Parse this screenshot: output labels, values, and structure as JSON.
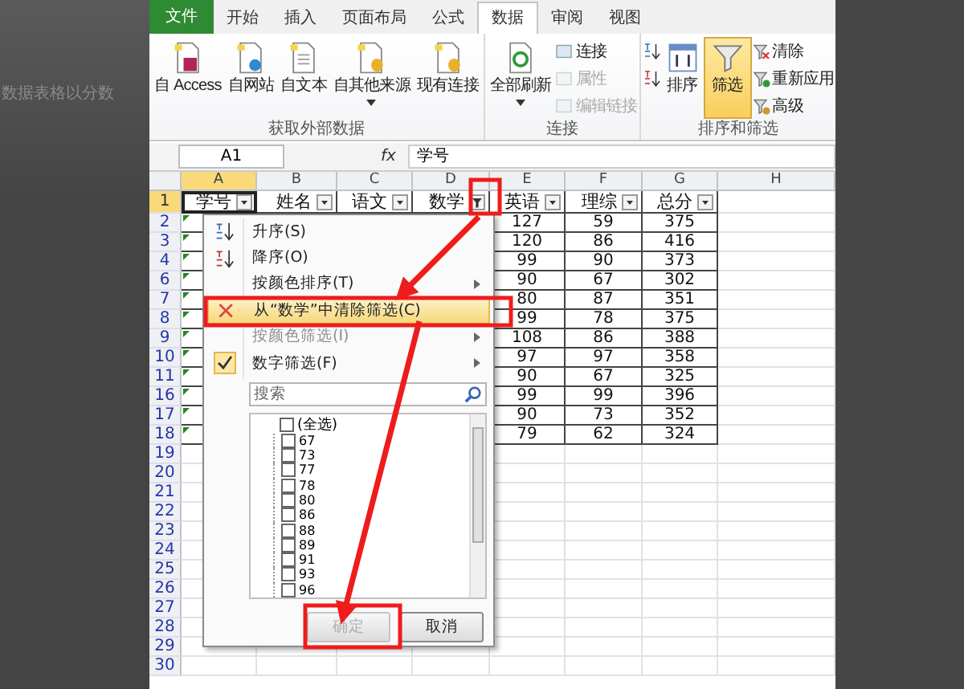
{
  "background_text": "数据表格以分数",
  "ribbon": {
    "tabs": [
      {
        "label": "文件",
        "kind": "file",
        "selected": false
      },
      {
        "label": "开始",
        "kind": "tab",
        "selected": false
      },
      {
        "label": "插入",
        "kind": "tab",
        "selected": false
      },
      {
        "label": "页面布局",
        "kind": "tab",
        "selected": false
      },
      {
        "label": "公式",
        "kind": "tab",
        "selected": false
      },
      {
        "label": "数据",
        "kind": "tab",
        "selected": true
      },
      {
        "label": "审阅",
        "kind": "tab",
        "selected": false
      },
      {
        "label": "视图",
        "kind": "tab",
        "selected": false
      }
    ],
    "groups": [
      {
        "title": "获取外部数据",
        "columns": [
          {
            "kind": "large",
            "items": [
              {
                "label": "自 Access",
                "kind": "access",
                "selected": false,
                "dropdown": false
              }
            ]
          },
          {
            "kind": "large",
            "items": [
              {
                "label": "自网站",
                "kind": "web",
                "selected": false,
                "dropdown": false
              }
            ]
          },
          {
            "kind": "large",
            "items": [
              {
                "label": "自文本",
                "kind": "text",
                "selected": false,
                "dropdown": false
              }
            ]
          },
          {
            "kind": "large",
            "items": [
              {
                "label": "自其他来源",
                "kind": "db",
                "selected": false,
                "dropdown": true
              }
            ]
          },
          {
            "kind": "large",
            "items": [
              {
                "label": "现有连接",
                "kind": "db",
                "selected": false,
                "dropdown": false
              }
            ]
          }
        ]
      },
      {
        "title": "连接",
        "columns": [
          {
            "kind": "large",
            "items": [
              {
                "label": "全部刷新",
                "kind": "refresh",
                "selected": false,
                "dropdown": true
              }
            ]
          },
          {
            "kind": "small",
            "items": [
              {
                "label": "连接",
                "kind": "link",
                "disabled": false
              },
              {
                "label": "属性",
                "kind": "props",
                "disabled": true
              },
              {
                "label": "编辑链接",
                "kind": "chain",
                "disabled": true
              }
            ]
          }
        ]
      },
      {
        "title": "排序和筛选",
        "columns": [
          {
            "kind": "small",
            "items": [
              {
                "kind": "sort-asc"
              },
              {
                "kind": "sort-desc"
              }
            ]
          },
          {
            "kind": "large",
            "items": [
              {
                "label": "排序",
                "kind": "sort",
                "selected": false,
                "dropdown": false
              }
            ]
          },
          {
            "kind": "large",
            "items": [
              {
                "label": "筛选",
                "kind": "filter",
                "selected": true,
                "dropdown": false
              }
            ]
          },
          {
            "kind": "small",
            "items": [
              {
                "label": "清除",
                "kind": "clear"
              },
              {
                "label": "重新应用",
                "kind": "reapply"
              },
              {
                "label": "高级",
                "kind": "advanced"
              }
            ]
          }
        ]
      }
    ]
  },
  "formula_bar": {
    "name_box": "A1",
    "fx": "fx",
    "value": "学号"
  },
  "sheet": {
    "columns": [
      "A",
      "B",
      "C",
      "D",
      "E",
      "F",
      "G",
      "H"
    ],
    "header_row": {
      "number": "1",
      "cells": [
        {
          "label": "学号",
          "filtered": false
        },
        {
          "label": "姓名",
          "filtered": false
        },
        {
          "label": "语文",
          "filtered": false
        },
        {
          "label": "数学",
          "filtered": true
        },
        {
          "label": "英语",
          "filtered": false
        },
        {
          "label": "理综",
          "filtered": false
        },
        {
          "label": "总分",
          "filtered": false
        }
      ]
    },
    "rows": [
      {
        "number": "2",
        "values": [
          "127",
          "59",
          "375"
        ]
      },
      {
        "number": "3",
        "values": [
          "120",
          "86",
          "416"
        ]
      },
      {
        "number": "4",
        "values": [
          "99",
          "90",
          "373"
        ]
      },
      {
        "number": "6",
        "values": [
          "90",
          "67",
          "302"
        ]
      },
      {
        "number": "7",
        "values": [
          "80",
          "87",
          "351"
        ]
      },
      {
        "number": "8",
        "values": [
          "99",
          "78",
          "375"
        ]
      },
      {
        "number": "9",
        "values": [
          "108",
          "86",
          "388"
        ]
      },
      {
        "number": "10",
        "values": [
          "97",
          "97",
          "358"
        ]
      },
      {
        "number": "11",
        "values": [
          "90",
          "67",
          "325"
        ]
      },
      {
        "number": "16",
        "values": [
          "99",
          "99",
          "396"
        ]
      },
      {
        "number": "17",
        "values": [
          "90",
          "73",
          "352"
        ]
      },
      {
        "number": "18",
        "values": [
          "79",
          "62",
          "324"
        ]
      },
      {
        "number": "19"
      },
      {
        "number": "20"
      },
      {
        "number": "21"
      },
      {
        "number": "22"
      },
      {
        "number": "23"
      },
      {
        "number": "24"
      },
      {
        "number": "25"
      },
      {
        "number": "26"
      },
      {
        "number": "27"
      },
      {
        "number": "28"
      },
      {
        "number": "29"
      },
      {
        "number": "30"
      }
    ]
  },
  "filter_menu": {
    "items": [
      {
        "label": "升序(S)",
        "kind": "sort-asc",
        "disabled": false,
        "selected": false,
        "checked": false,
        "submenu": false
      },
      {
        "label": "降序(O)",
        "kind": "sort-desc",
        "disabled": false,
        "selected": false,
        "checked": false,
        "submenu": false
      },
      {
        "label": "按颜色排序(T)",
        "kind": "plain",
        "disabled": false,
        "selected": false,
        "checked": false,
        "submenu": true
      },
      {
        "label": "从“数学”中清除筛选(C)",
        "kind": "clear",
        "disabled": false,
        "selected": true,
        "checked": false,
        "submenu": false
      },
      {
        "label": "按颜色筛选(I)",
        "kind": "plain",
        "disabled": true,
        "selected": false,
        "checked": false,
        "submenu": true
      },
      {
        "label": "数字筛选(F)",
        "kind": "plain",
        "disabled": false,
        "selected": false,
        "checked": true,
        "submenu": true
      }
    ],
    "search": {
      "placeholder": "搜索"
    },
    "values": [
      {
        "label": "(全选)",
        "checked": false
      },
      {
        "label": "67",
        "checked": false
      },
      {
        "label": "73",
        "checked": false
      },
      {
        "label": "77",
        "checked": false
      },
      {
        "label": "78",
        "checked": false
      },
      {
        "label": "80",
        "checked": false
      },
      {
        "label": "86",
        "checked": false
      },
      {
        "label": "88",
        "checked": false
      },
      {
        "label": "89",
        "checked": false
      },
      {
        "label": "91",
        "checked": false
      },
      {
        "label": "93",
        "checked": false
      },
      {
        "label": "96",
        "checked": false
      }
    ],
    "buttons": [
      {
        "label": "确定",
        "disabled": true
      },
      {
        "label": "取消",
        "disabled": false
      }
    ]
  }
}
